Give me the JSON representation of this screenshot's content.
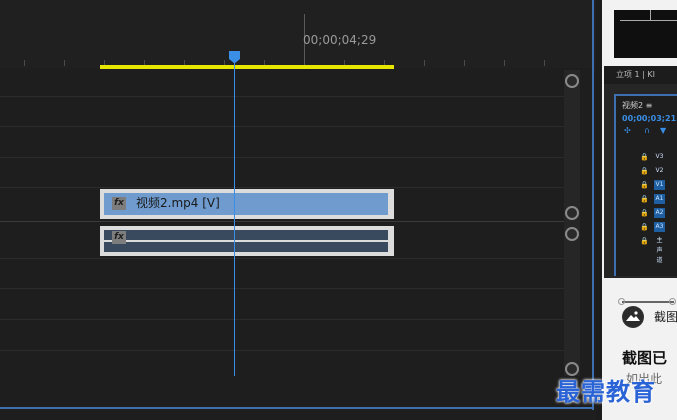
{
  "timeline": {
    "timecode": "00;00;04;29",
    "video_clip": {
      "fx": "fx",
      "label": "视频2.mp4 [V]"
    },
    "audio_clip": {
      "fx": "fx"
    }
  },
  "mini_window": {
    "topbar": "立项 1  |  KI",
    "panel_title": "视频2  ≡",
    "timecode": "00;00;03;21",
    "rows": [
      {
        "lock": "🔒",
        "tag": "V3",
        "on": false
      },
      {
        "lock": "🔒",
        "tag": "V2",
        "on": false
      },
      {
        "lock": "🔒",
        "tag": "V1",
        "on": true
      },
      {
        "lock": "🔒",
        "tag": "A1",
        "on": true
      },
      {
        "lock": "🔒",
        "tag": "A2",
        "on": true
      },
      {
        "lock": "🔒",
        "tag": "A3",
        "on": true
      },
      {
        "lock": "🔒",
        "tag": "主声道",
        "on": false
      }
    ]
  },
  "toast": {
    "icon_text": "截图",
    "title": "截图已",
    "subtitle": "如出此"
  },
  "watermark": "最需教育",
  "colors": {
    "playhead": "#3a8ee6",
    "work_area": "#e6e600",
    "video_clip": "#6f9bcf",
    "audio_clip": "#3a4a5e",
    "panel_border": "#3e6fb0"
  }
}
